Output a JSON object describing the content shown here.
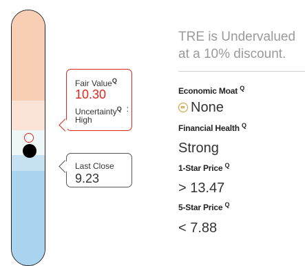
{
  "colors": {
    "accent_red": "#e1251b",
    "overvalued_high": "#f8cfb5",
    "overvalued_low": "#fbe2d6",
    "fair": "#eef6f7",
    "undervalued_low": "#c6e1f1",
    "undervalued_high": "#a9d4ef",
    "moat_icon": "#c79a2d"
  },
  "fair_value_box": {
    "title": "Fair Value",
    "value": "10.30",
    "uncertainty_label": "Uncertainty",
    "uncertainty_value": "High",
    "colon": ":",
    "info_icon": "Q"
  },
  "last_close_box": {
    "title": "Last Close",
    "value": "9.23"
  },
  "summary": {
    "line1": "TRE is Undervalued",
    "line2": "at a 10% discount."
  },
  "metrics": {
    "economic_moat": {
      "label": "Economic Moat",
      "value": "None",
      "icon": "moat-icon"
    },
    "financial_health": {
      "label": "Financial Health",
      "value": "Strong"
    },
    "one_star_price": {
      "label": "1-Star Price",
      "symbol": ">",
      "value": "13.47"
    },
    "five_star_price": {
      "label": "5-Star Price",
      "symbol": "<",
      "value": "7.88"
    }
  }
}
